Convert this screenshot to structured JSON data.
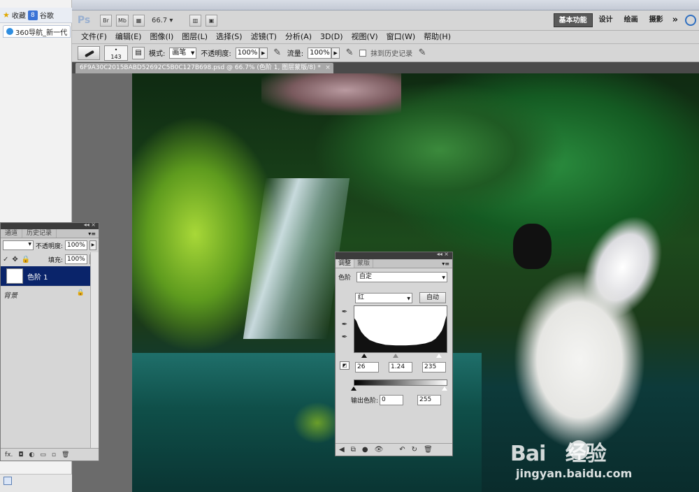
{
  "browser": {
    "favorites_label": "收藏",
    "google_label": "谷歌",
    "tab_label": "360导航_新一代"
  },
  "appbar": {
    "logo": "Ps",
    "btn_bridge": "Br",
    "btn_minibridge": "Mb",
    "zoom": "66.7",
    "workspaces": [
      "基本功能",
      "设计",
      "绘画",
      "摄影"
    ],
    "more": "»"
  },
  "menubar": [
    "文件(F)",
    "编辑(E)",
    "图像(I)",
    "图层(L)",
    "选择(S)",
    "滤镜(T)",
    "分析(A)",
    "3D(D)",
    "视图(V)",
    "窗口(W)",
    "帮助(H)"
  ],
  "options": {
    "brush_size": "143",
    "mode_label": "模式:",
    "mode_value": "画笔",
    "opacity_label": "不透明度:",
    "opacity_value": "100%",
    "flow_label": "流量:",
    "flow_value": "100%",
    "erase_history_label": "抹到历史记录"
  },
  "document": {
    "tab_title": "6F9A30C2015BABD52692C5B0C127B698.psd @ 66.7% (色阶 1, 图层蒙版/8) *",
    "close": "×"
  },
  "layers_panel": {
    "tabs": [
      "通道",
      "历史记录"
    ],
    "opacity_label": "不透明度:",
    "opacity_value": "100%",
    "fill_label": "填充:",
    "fill_value": "100%",
    "layers": [
      {
        "name": "色阶 1",
        "selected": true
      },
      {
        "name": "背景",
        "selected": false
      }
    ],
    "footer_fx": "fx."
  },
  "adjustments_panel": {
    "tabs": [
      "调整",
      "蒙版"
    ],
    "preset_label": "色阶",
    "preset_value": "自定",
    "channel_value": "红",
    "auto_button": "自动",
    "input_black": "26",
    "input_gamma": "1.24",
    "input_white": "235",
    "output_label": "输出色阶:",
    "output_black": "0",
    "output_white": "255"
  },
  "watermark": {
    "logo_text": "Bai",
    "logo_text2": "经验",
    "url": "jingyan.baidu.com"
  },
  "colors": {
    "layer_selected_bg": "#0a246a",
    "workspace_active_bg": "#5a5a5a",
    "panel_bg": "#d6d6d6"
  }
}
